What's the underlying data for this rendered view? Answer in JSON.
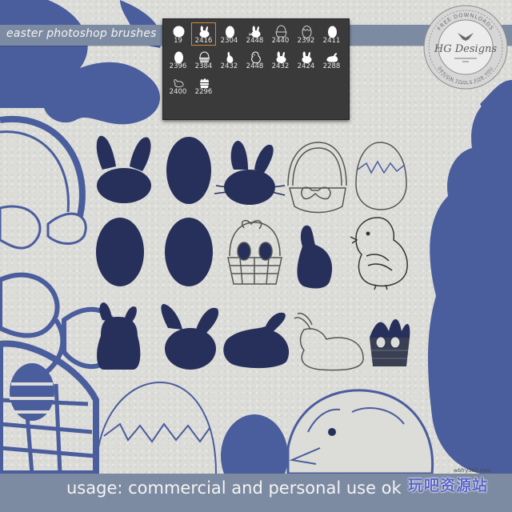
{
  "header": {
    "title": "easter photoshop brushes"
  },
  "brush_panel": {
    "presets": [
      {
        "icon": "round-brush-icon",
        "size": "19",
        "selected": false
      },
      {
        "icon": "bunny-head-icon",
        "size": "2416",
        "selected": true
      },
      {
        "icon": "egg-icon",
        "size": "2304",
        "selected": false
      },
      {
        "icon": "bunny-head-whiskers-icon",
        "size": "2448",
        "selected": false
      },
      {
        "icon": "basket-icon",
        "size": "2440",
        "selected": false
      },
      {
        "icon": "cracked-egg-icon",
        "size": "2392",
        "selected": false
      },
      {
        "icon": "egg-icon",
        "size": "2411",
        "selected": false
      },
      {
        "icon": "egg-icon",
        "size": "2396",
        "selected": false
      },
      {
        "icon": "egg-basket-icon",
        "size": "2384",
        "selected": false
      },
      {
        "icon": "sitting-bunny-icon",
        "size": "2432",
        "selected": false
      },
      {
        "icon": "chick-icon",
        "size": "2448",
        "selected": false
      },
      {
        "icon": "bunny-head-icon",
        "size": "2432",
        "selected": false
      },
      {
        "icon": "bunny-head-icon",
        "size": "2424",
        "selected": false
      },
      {
        "icon": "lying-bunny-icon",
        "size": "2288",
        "selected": false
      },
      {
        "icon": "rabbit-outline-icon",
        "size": "2400",
        "selected": false
      },
      {
        "icon": "grass-basket-icon",
        "size": "2296",
        "selected": false
      }
    ]
  },
  "badge": {
    "top_text": "FREE DOWNLOADS",
    "brand": "HG Designs",
    "bottom_text": "DESIGN TOOLS FOR YOU"
  },
  "footer": {
    "usage": "usage: commercial and personal use ok"
  },
  "watermark": {
    "url": "wbfry365.com",
    "text": "玩吧资源站"
  },
  "colors": {
    "accent": "#7c8ba2",
    "navy": "#27305a",
    "shape_blue": "#4a5d9c",
    "panel": "#3a3a3a",
    "selection": "#d08a3a"
  }
}
